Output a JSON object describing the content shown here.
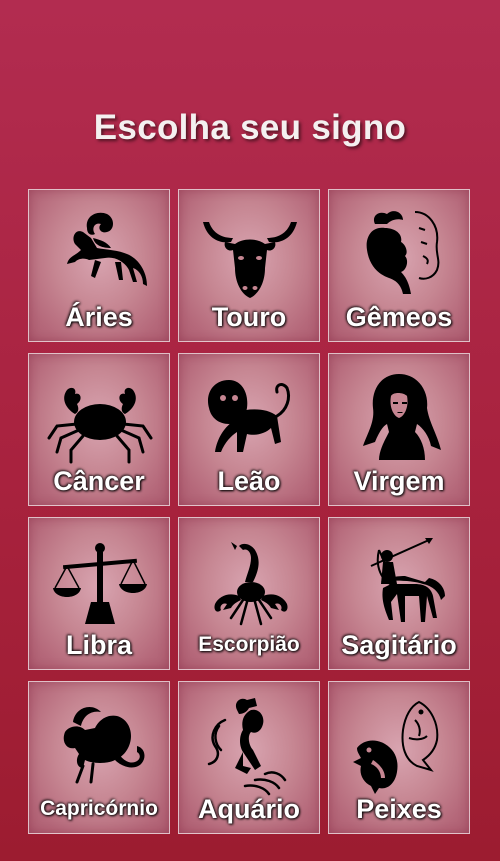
{
  "header": {
    "title": "Escolha seu signo"
  },
  "signs": [
    {
      "label": "Áries",
      "icon": "aries-ram-icon"
    },
    {
      "label": "Touro",
      "icon": "taurus-bull-icon"
    },
    {
      "label": "Gêmeos",
      "icon": "gemini-twins-icon"
    },
    {
      "label": "Câncer",
      "icon": "cancer-crab-icon"
    },
    {
      "label": "Leão",
      "icon": "leo-lion-icon"
    },
    {
      "label": "Virgem",
      "icon": "virgo-maiden-icon"
    },
    {
      "label": "Libra",
      "icon": "libra-scales-icon"
    },
    {
      "label": "Escorpião",
      "icon": "scorpio-scorpion-icon"
    },
    {
      "label": "Sagitário",
      "icon": "sagittarius-archer-icon"
    },
    {
      "label": "Capricórnio",
      "icon": "capricorn-goat-icon"
    },
    {
      "label": "Aquário",
      "icon": "aquarius-water-bearer-icon"
    },
    {
      "label": "Peixes",
      "icon": "pisces-fish-icon"
    }
  ]
}
